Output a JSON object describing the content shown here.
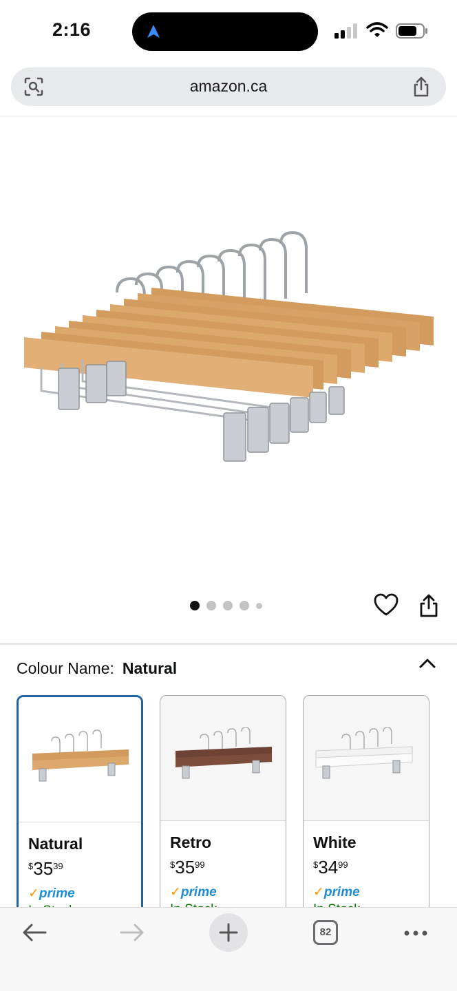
{
  "status_bar": {
    "time": "2:16"
  },
  "browser": {
    "url": "amazon.ca",
    "tab_count": "82"
  },
  "gallery": {
    "image_count": 5,
    "active_index": 0
  },
  "variation": {
    "label": "Colour Name:",
    "selected": "Natural",
    "options": [
      {
        "name": "Natural",
        "price_symbol": "$",
        "price_whole": "35",
        "price_fraction": "39",
        "prime": "prime",
        "stock": "In Stock"
      },
      {
        "name": "Retro",
        "price_symbol": "$",
        "price_whole": "35",
        "price_fraction": "99",
        "prime": "prime",
        "stock": "In Stock"
      },
      {
        "name": "White",
        "price_symbol": "$",
        "price_whole": "34",
        "price_fraction": "99",
        "prime": "prime",
        "stock": "In Stock"
      }
    ]
  },
  "colors": {
    "accent": "#2162a1",
    "prime": "#1d8dd6",
    "prime_check": "#ff9900",
    "stock": "#007600",
    "wood_natural": "#d9a56a",
    "wood_retro": "#6e4234",
    "wood_white": "#f2f2f2"
  },
  "icons": [
    "location-arrow-icon",
    "signal-icon",
    "wifi-icon",
    "battery-icon",
    "lens-icon",
    "share-icon",
    "heart-icon",
    "chevron-up-icon",
    "back-icon",
    "forward-icon",
    "plus-icon",
    "tabs-icon",
    "more-icon"
  ]
}
